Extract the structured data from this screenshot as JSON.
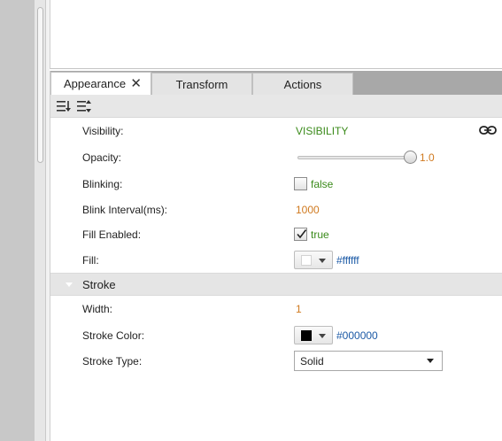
{
  "tabs": [
    {
      "label": "Appearance",
      "active": true,
      "closable": true
    },
    {
      "label": "Transform",
      "active": false
    },
    {
      "label": "Actions",
      "active": false
    }
  ],
  "toolbar": {
    "icons": [
      "sort-categorized-icon",
      "sort-alphabetical-icon"
    ]
  },
  "properties": {
    "visibility": {
      "label": "Visibility:",
      "value": "VISIBILITY",
      "icon": "link-icon"
    },
    "opacity": {
      "label": "Opacity:",
      "value": "1.0",
      "level": 1.0
    },
    "blinking": {
      "label": "Blinking:",
      "checked": false,
      "value": "false"
    },
    "blink_interval": {
      "label": "Blink Interval(ms):",
      "value": "1000"
    },
    "fill_enabled": {
      "label": "Fill Enabled:",
      "checked": true,
      "value": "true"
    },
    "fill": {
      "label": "Fill:",
      "color": "#ffffff",
      "value": "#ffffff"
    }
  },
  "stroke_section": {
    "title": "Stroke",
    "width": {
      "label": "Width:",
      "value": "1"
    },
    "stroke_color": {
      "label": "Stroke Color:",
      "color": "#000000",
      "value": "#000000"
    },
    "stroke_type": {
      "label": "Stroke Type:",
      "value": "Solid"
    }
  },
  "colors": {
    "green_value": "#3a8a1a",
    "orange_value": "#d07a20",
    "blue_value": "#1c5aa6",
    "tabbar_bg": "#a8a8a8",
    "section_bg": "#e5e5e5"
  }
}
